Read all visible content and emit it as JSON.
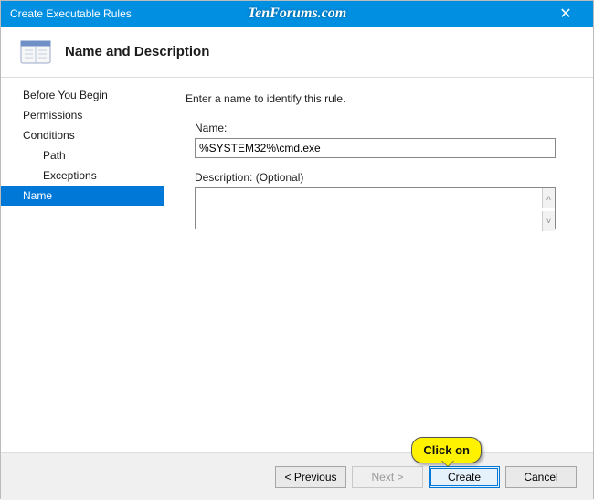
{
  "window": {
    "title": "Create Executable Rules",
    "watermark": "TenForums.com"
  },
  "header": {
    "title": "Name and Description"
  },
  "sidebar": {
    "steps": [
      "Before You Begin",
      "Permissions",
      "Conditions",
      "Path",
      "Exceptions",
      "Name"
    ]
  },
  "form": {
    "intro": "Enter a name to identify this rule.",
    "name_label": "Name:",
    "name_value": "%SYSTEM32%\\cmd.exe",
    "desc_label": "Description: (Optional)",
    "desc_value": ""
  },
  "buttons": {
    "previous": "< Previous",
    "next": "Next >",
    "create": "Create",
    "cancel": "Cancel"
  },
  "callout": "Click on"
}
